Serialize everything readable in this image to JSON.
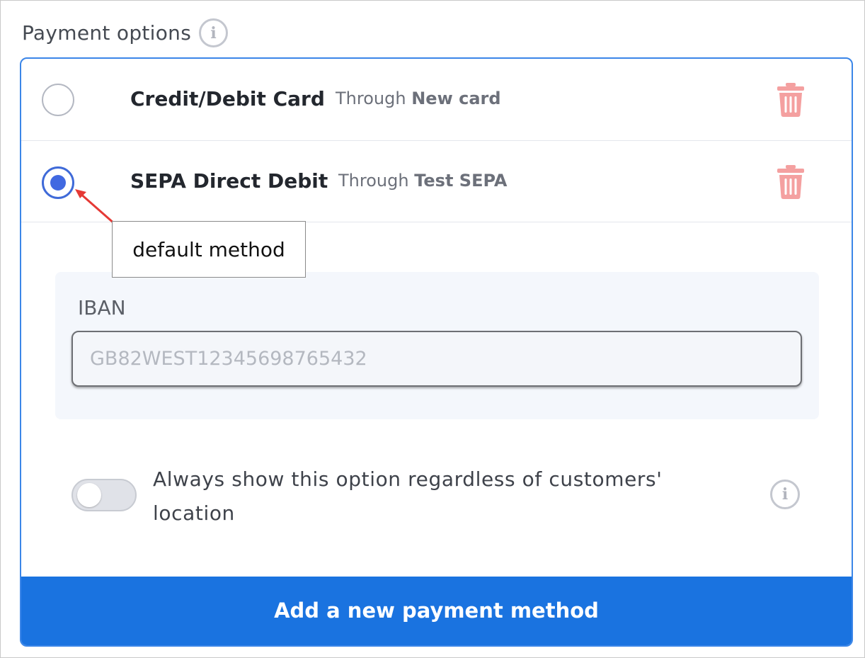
{
  "section": {
    "title": "Payment options",
    "info_icon": "info-icon"
  },
  "methods": [
    {
      "name": "Credit/Debit Card",
      "through_prefix": "Through",
      "through_value": "New card",
      "selected": false,
      "delete_icon": "trash-icon"
    },
    {
      "name": "SEPA Direct Debit",
      "through_prefix": "Through",
      "through_value": "Test SEPA",
      "selected": true,
      "delete_icon": "trash-icon"
    }
  ],
  "iban": {
    "label": "IBAN",
    "placeholder": "GB82WEST12345698765432",
    "value": ""
  },
  "always_show": {
    "label": "Always show this option regardless of customers' location",
    "enabled": false,
    "info_icon": "info-icon"
  },
  "add_button": {
    "label": "Add a new payment method"
  },
  "annotation": {
    "label": "default method"
  },
  "colors": {
    "accent": "#1a73e0",
    "radio_selected": "#4169e1",
    "trash": "#f4a0a0",
    "annotation_arrow": "#e53935"
  }
}
